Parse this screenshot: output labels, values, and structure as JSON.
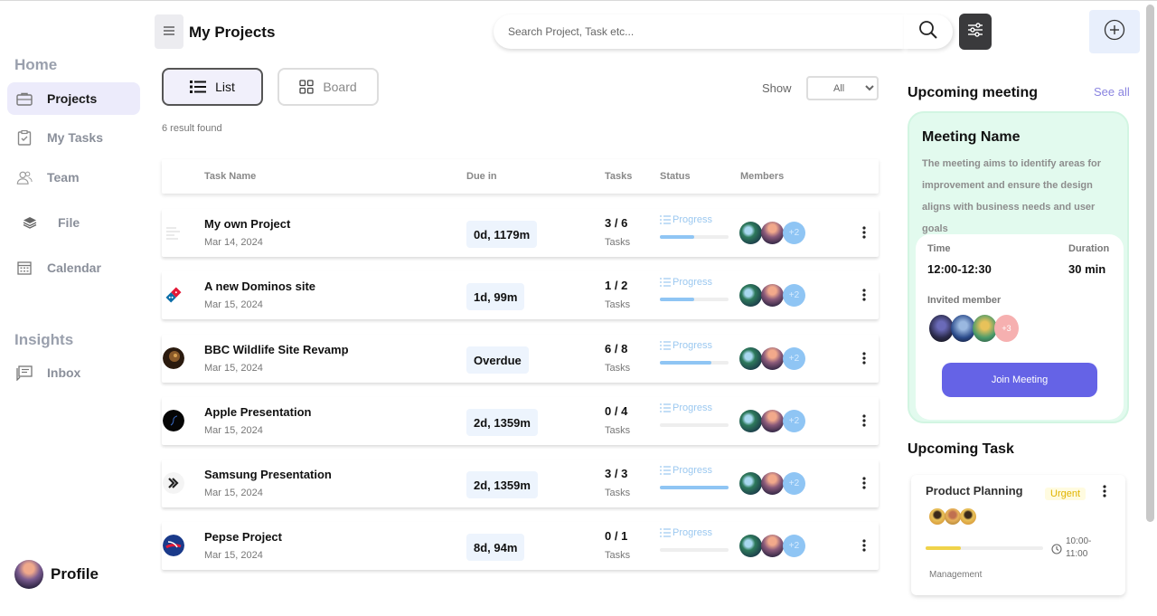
{
  "sidebar": {
    "home_title": "Home",
    "insights_title": "Insights",
    "items": [
      {
        "label": "Projects"
      },
      {
        "label": "My Tasks"
      },
      {
        "label": "Team"
      },
      {
        "label": "File"
      },
      {
        "label": "Calendar"
      },
      {
        "label": "Inbox"
      }
    ],
    "profile_label": "Profile"
  },
  "header": {
    "title": "My Projects",
    "search_placeholder": "Search Project, Task etc..."
  },
  "views": {
    "list_label": "List",
    "board_label": "Board",
    "show_label": "Show",
    "show_selected": "All",
    "result_text": "6 result found"
  },
  "table": {
    "headers": [
      "Task Name",
      "Due in",
      "Tasks",
      "Status",
      "Members"
    ],
    "rows": [
      {
        "name": "My own Project",
        "date": "Mar 14, 2024",
        "due": "0d, 1179m",
        "tasks": "3 / 6",
        "tasks_label": "Tasks",
        "status": "Progress",
        "progress": 0.5,
        "extra_members": "+2"
      },
      {
        "name": "A new Dominos site",
        "date": "Mar 15, 2024",
        "due": "1d, 99m",
        "tasks": "1 / 2",
        "tasks_label": "Tasks",
        "status": "Progress",
        "progress": 0.5,
        "extra_members": "+2"
      },
      {
        "name": "BBC Wildlife Site Revamp",
        "date": "Mar 15, 2024",
        "due": "Overdue",
        "tasks": "6 / 8",
        "tasks_label": "Tasks",
        "status": "Progress",
        "progress": 0.75,
        "extra_members": "+2"
      },
      {
        "name": "Apple Presentation",
        "date": "Mar 15, 2024",
        "due": "2d, 1359m",
        "tasks": "0 / 4",
        "tasks_label": "Tasks",
        "status": "Progress",
        "progress": 0,
        "extra_members": "+2"
      },
      {
        "name": "Samsung Presentation",
        "date": "Mar 15, 2024",
        "due": "2d, 1359m",
        "tasks": "3 / 3",
        "tasks_label": "Tasks",
        "status": "Progress",
        "progress": 1,
        "extra_members": "+2"
      },
      {
        "name": "Pepse Project",
        "date": "Mar 15, 2024",
        "due": "8d, 94m",
        "tasks": "0 / 1",
        "tasks_label": "Tasks",
        "status": "Progress",
        "progress": 0,
        "extra_members": "+2"
      }
    ]
  },
  "meeting": {
    "section_title": "Upcoming meeting",
    "see_all": "See all",
    "name": "Meeting Name",
    "description": "The meeting aims to identify areas for improvement and ensure the design aligns with business needs and user goals",
    "time_label": "Time",
    "time_value": "12:00-12:30",
    "duration_label": "Duration",
    "duration_value": "30 min",
    "invited_label": "Invited member",
    "invited_extra": "+3",
    "join_label": "Join Meeting"
  },
  "upcoming_task": {
    "section_title": "Upcoming Task",
    "title": "Product Planning",
    "badge": "Urgent",
    "progress": 0.3,
    "time": "10:00-11:00",
    "tag": "Management"
  },
  "colors": {
    "accent": "#6563e6",
    "active_nav_bg": "#ecebfb",
    "progress_blue": "#8fc5f4",
    "urgent_yellow": "#f0d34a",
    "meeting_bg": "#e2faee"
  }
}
